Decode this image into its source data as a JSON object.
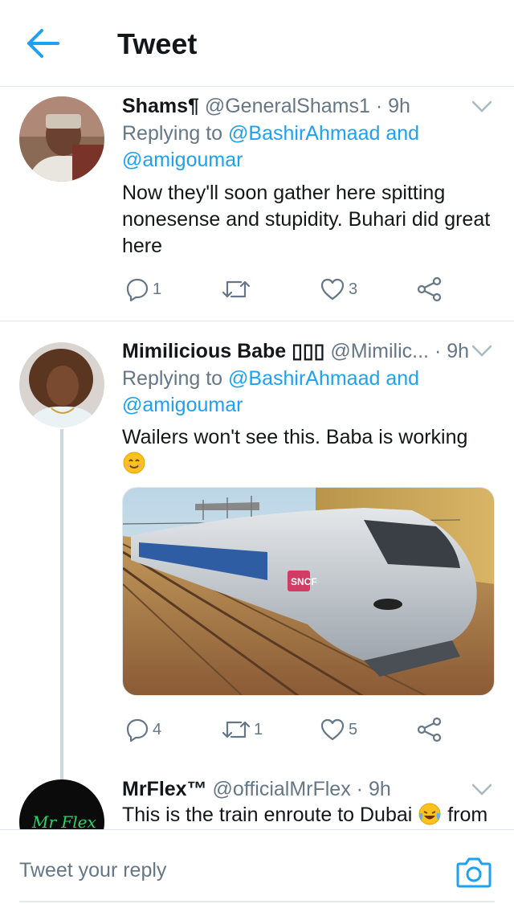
{
  "header": {
    "title": "Tweet",
    "back_icon": "back-arrow-icon"
  },
  "colors": {
    "accent": "#1da1f2",
    "secondary_text": "#657786",
    "divider": "#e1e8ed",
    "thread_line": "#ccd6dd"
  },
  "tweets": [
    {
      "name": "Shams¶",
      "handle": "@GeneralShams1",
      "dot": "·",
      "time": "9h",
      "replying_prefix": "Replying to ",
      "mention1": "@BashirAhmaad",
      "and": " and",
      "mention2": "@amigoumar",
      "text": "Now they'll soon gather here spitting nonesense and stupidity. Buhari did great here",
      "reply_count": "1",
      "retweet_count": "",
      "like_count": "3"
    },
    {
      "name": "Mimilicious Babe ▯▯▯",
      "handle": "@Mimilic...",
      "dot": "·",
      "time": "9h",
      "replying_prefix": "Replying to ",
      "mention1": "@BashirAhmaad",
      "and": " and",
      "mention2": "@amigoumar",
      "text": "Wailers won't see this. Baba is working",
      "emoji": "smiling-face-emoji",
      "media_label": "SNCF",
      "reply_count": "4",
      "retweet_count": "1",
      "like_count": "5"
    },
    {
      "name": "MrFlex™",
      "handle": "@officialMrFlex",
      "dot": "·",
      "time": "9h",
      "text_before_emoji": "This is the train enroute to Dubai ",
      "emoji": "tears-of-joy-emoji",
      "text_after_emoji": " from",
      "avatar_text": "Mr Flex"
    }
  ],
  "compose": {
    "placeholder": "Tweet your reply",
    "camera_icon": "camera-icon"
  }
}
